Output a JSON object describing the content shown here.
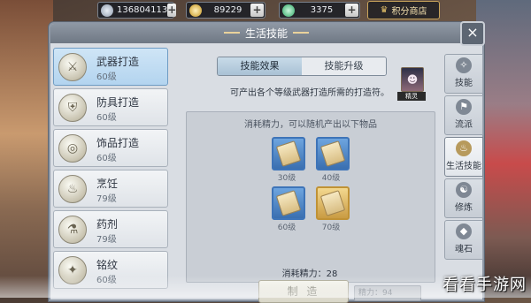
{
  "topbar": {
    "silver": "136804113",
    "gold": "89229",
    "gem": "3375",
    "shop_label": "积分商店"
  },
  "panel": {
    "title": "生活技能",
    "close_label": "×"
  },
  "skills": [
    {
      "name": "武器打造",
      "level": "60级",
      "icon": "sword-icon"
    },
    {
      "name": "防具打造",
      "level": "60级",
      "icon": "armor-icon"
    },
    {
      "name": "饰品打造",
      "level": "60级",
      "icon": "ring-icon"
    },
    {
      "name": "烹饪",
      "level": "79级",
      "icon": "pot-icon"
    },
    {
      "name": "药剂",
      "level": "79级",
      "icon": "potion-icon"
    },
    {
      "name": "铭纹",
      "level": "60级",
      "icon": "rune-icon"
    }
  ],
  "tabs": {
    "effect": "技能效果",
    "upgrade": "技能升级"
  },
  "companion": {
    "label": "精灵"
  },
  "description": "可产出各个等级武器打造所需的打造符。",
  "reward": {
    "desc": "消耗精力，可以随机产出以下物品",
    "slots": [
      {
        "level": "30级",
        "color": "blue"
      },
      {
        "level": "40级",
        "color": "blue"
      },
      {
        "level": "60级",
        "color": "blue"
      },
      {
        "level": "70级",
        "color": "gold"
      }
    ],
    "cost": "消耗精力：28",
    "make_label": "制 造",
    "energy": "精力：94"
  },
  "side_tabs": [
    {
      "label": "技能",
      "icon": "skill-icon",
      "active": false
    },
    {
      "label": "流派",
      "icon": "school-icon",
      "active": false
    },
    {
      "label": "生活技能",
      "icon": "life-skill-icon",
      "active": true
    },
    {
      "label": "修炼",
      "icon": "cultivate-icon",
      "active": false
    },
    {
      "label": "魂石",
      "icon": "soulstone-icon",
      "active": false
    }
  ],
  "watermark": "看看手游网"
}
